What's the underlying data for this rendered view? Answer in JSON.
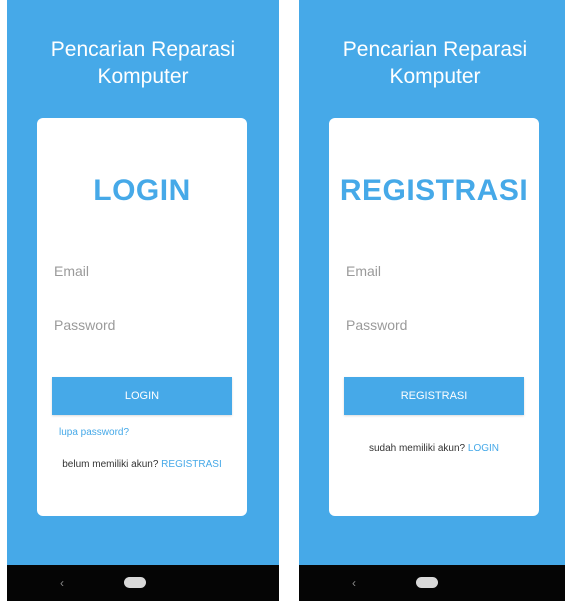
{
  "login_screen": {
    "app_title": "Pencarian Reparasi\nKomputer",
    "heading": "LOGIN",
    "email_placeholder": "Email",
    "password_placeholder": "Password",
    "button_label": "LOGIN",
    "forgot_password": "lupa password?",
    "switch_prompt": "belum memiliki akun?",
    "switch_link": "REGISTRASI"
  },
  "register_screen": {
    "app_title": "Pencarian Reparasi\nKomputer",
    "heading": "REGISTRASI",
    "email_placeholder": "Email",
    "password_placeholder": "Password",
    "button_label": "REGISTRASI",
    "switch_prompt": "sudah memiliki akun?",
    "switch_link": "LOGIN"
  },
  "navigation_bar": {
    "back_glyph": "‹"
  },
  "colors": {
    "primary": "#46a9e8",
    "card": "#ffffff",
    "nav_bar": "#050505"
  },
  "icons": [
    "back-icon",
    "home-icon"
  ]
}
